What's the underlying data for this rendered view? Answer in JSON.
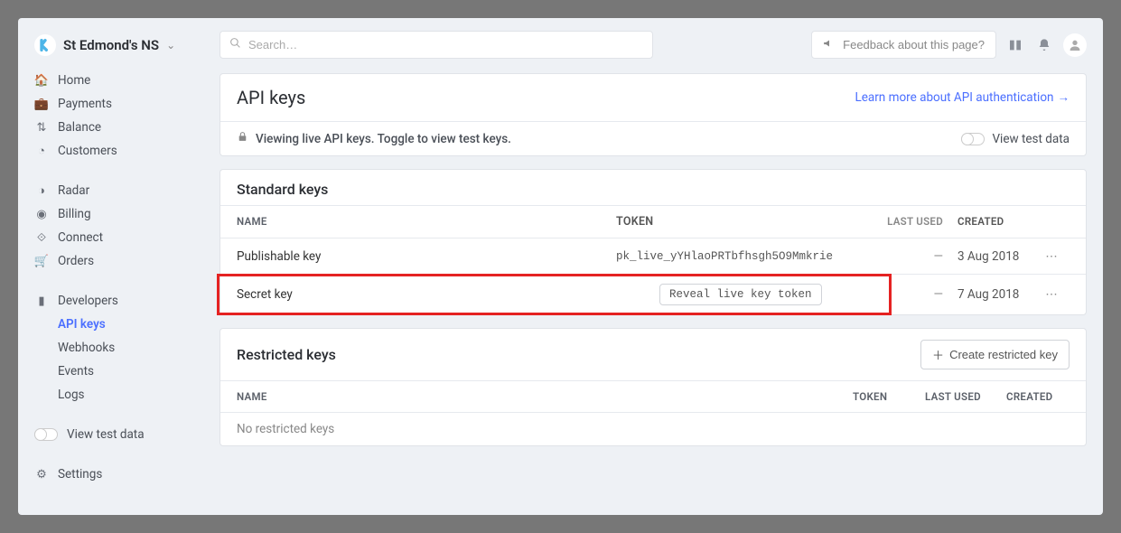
{
  "org": {
    "name": "St Edmond's NS"
  },
  "search": {
    "placeholder": "Search…"
  },
  "topbar": {
    "feedback": "Feedback about this page?"
  },
  "sidebar": {
    "groups": [
      [
        {
          "label": "Home",
          "icon": "home"
        },
        {
          "label": "Payments",
          "icon": "briefcase"
        },
        {
          "label": "Balance",
          "icon": "arrows"
        },
        {
          "label": "Customers",
          "icon": "user-circle"
        }
      ],
      [
        {
          "label": "Radar",
          "icon": "radar"
        },
        {
          "label": "Billing",
          "icon": "target"
        },
        {
          "label": "Connect",
          "icon": "link"
        },
        {
          "label": "Orders",
          "icon": "basket"
        }
      ],
      [
        {
          "label": "Developers",
          "icon": "terminal"
        }
      ]
    ],
    "dev_sub": [
      {
        "label": "API keys",
        "active": true
      },
      {
        "label": "Webhooks"
      },
      {
        "label": "Events"
      },
      {
        "label": "Logs"
      }
    ],
    "view_test": "View test data",
    "settings": {
      "label": "Settings"
    }
  },
  "page": {
    "title": "API keys",
    "learn_more": "Learn more about API authentication",
    "info": "Viewing live API keys. Toggle to view test keys.",
    "view_test": "View test data"
  },
  "standard": {
    "title": "Standard keys",
    "cols": {
      "name": "NAME",
      "token": "TOKEN",
      "used": "LAST USED",
      "created": "CREATED"
    },
    "rows": [
      {
        "name": "Publishable key",
        "token": "pk_live_yYHlaoPRTbfhsgh5O9Mmkrie",
        "used": "—",
        "created": "3 Aug 2018"
      },
      {
        "name": "Secret key",
        "reveal": "Reveal live key token",
        "used": "—",
        "created": "7 Aug 2018"
      }
    ]
  },
  "restricted": {
    "title": "Restricted keys",
    "create": "Create restricted key",
    "cols": {
      "name": "NAME",
      "token": "TOKEN",
      "used": "LAST USED",
      "created": "CREATED"
    },
    "empty": "No restricted keys"
  }
}
